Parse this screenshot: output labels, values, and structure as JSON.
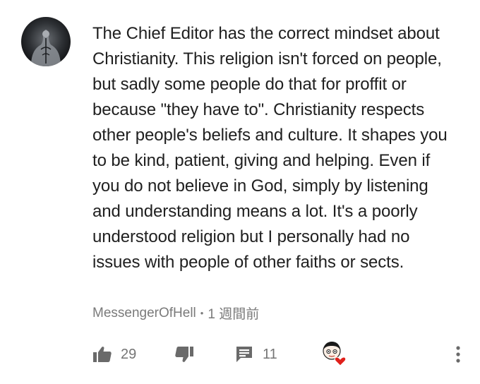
{
  "comment": {
    "avatar_icon": "user-avatar-tattoo-back",
    "text": "The Chief Editor has the correct mindset about Christianity. This religion isn't forced on people, but sadly some people do that for proffit or because \"they have to\". Christianity respects other people's beliefs and culture. It shapes you to be kind, patient, giving and helping. Even if you do not believe in God, simply by listening and understanding means a lot. It's a poorly understood religion but I personally had no issues with people of other faiths or sects.",
    "author": "MessengerOfHell",
    "separator": "•",
    "time_ago": "1 週間前"
  },
  "actions": {
    "like_icon": "thumbs-up-icon",
    "like_count": "29",
    "dislike_icon": "thumbs-down-icon",
    "reply_icon": "comment-icon",
    "reply_count": "11",
    "creator_heart_icon": "creator-heart-icon",
    "more_icon": "more-vertical-icon"
  },
  "colors": {
    "text": "#202020",
    "meta": "#7a7a7a",
    "icon": "#757575",
    "heart": "#e0201b"
  }
}
